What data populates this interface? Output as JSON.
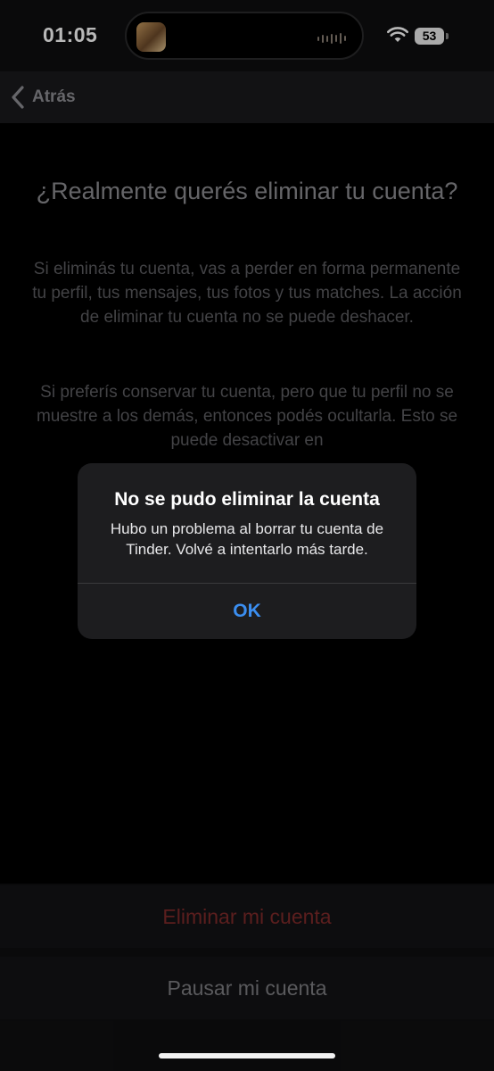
{
  "status_bar": {
    "time": "01:05",
    "battery": "53"
  },
  "nav": {
    "back_label": "Atrás"
  },
  "content": {
    "title": "¿Realmente querés eliminar tu cuenta?",
    "paragraph_1": "Si eliminás tu cuenta, vas a perder en forma permanente tu perfil, tus mensajes, tus fotos y tus matches. La acción de eliminar tu cuenta no se puede deshacer.",
    "paragraph_2": "Si preferís conservar tu cuenta, pero que tu perfil no se muestre a los demás, entonces podés ocultarla. Esto se puede desactivar en"
  },
  "alert": {
    "title": "No se pudo eliminar la cuenta",
    "message": "Hubo un problema al borrar tu cuenta de Tinder. Volvé a intentarlo más tarde.",
    "ok_label": "OK"
  },
  "actions": {
    "delete_label": "Eliminar mi cuenta",
    "pause_label": "Pausar mi cuenta"
  },
  "colors": {
    "delete_text": "#7e2a2a",
    "alert_button": "#3b8ef0"
  }
}
